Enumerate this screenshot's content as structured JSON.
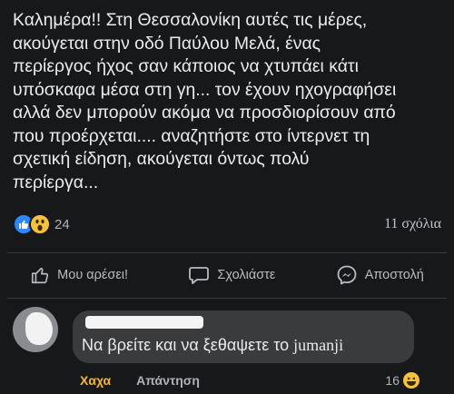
{
  "post": {
    "lines": [
      "Καλημέρα!! Στη Θεσσαλονίκη αυτές τις μέρες,",
      "ακούγεται στην οδό Παύλου Μελά, ένας",
      "περίεργος ήχος σαν κάποιος να χτυπάει κάτι",
      "υπόσκαφα μέσα στη γη...   τον έχουν ηχογραφήσει",
      "αλλά δεν μπορούν ακόμα να προσδιορίσουν από",
      "που προέρχεται....  αναζητήστε στο ίντερνετ τη",
      "σχετική είδηση, ακούγεται όντως πολύ",
      "περίεργα..."
    ]
  },
  "stats": {
    "reaction_count": "24",
    "comments_count": "11 σχόλια",
    "reaction_icons": [
      "like-icon",
      "wow-icon"
    ]
  },
  "actions": {
    "like": "Μου αρέσει!",
    "comment": "Σχολιάστε",
    "share": "Αποστολή"
  },
  "comment": {
    "text_main": "Να βρείτε και να ξεθαψετε το ",
    "text_end": "jumanji",
    "reaction_label": "Χαχα",
    "reply_label": "Απάντηση",
    "reaction_count": "16"
  },
  "colors": {
    "background": "#17181a",
    "accent_like": "#2d88ff",
    "haha": "#f7b928",
    "bubble": "#3a3b3c"
  }
}
